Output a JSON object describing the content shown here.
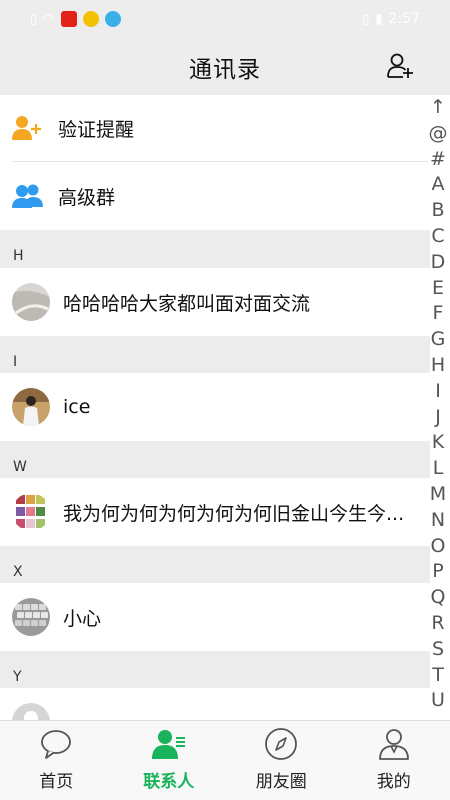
{
  "header": {
    "title": "通讯录"
  },
  "tools": [
    {
      "label": "验证提醒",
      "icon": "add-user-icon"
    },
    {
      "label": "高级群",
      "icon": "group-icon"
    }
  ],
  "sections": [
    {
      "letter": "H",
      "contacts": [
        {
          "name": "哈哈哈哈大家都叫面对面交流",
          "avatar": "photo-avatar"
        }
      ]
    },
    {
      "letter": "I",
      "contacts": [
        {
          "name": "ice",
          "avatar": "photo-avatar"
        }
      ]
    },
    {
      "letter": "W",
      "contacts": [
        {
          "name": "我为何为何为何为何为何旧金山今生今...",
          "avatar": "photo-avatar"
        }
      ]
    },
    {
      "letter": "X",
      "contacts": [
        {
          "name": "小心",
          "avatar": "photo-avatar"
        }
      ]
    },
    {
      "letter": "Y",
      "contacts": [
        {
          "name": "",
          "avatar": "default-avatar"
        }
      ]
    }
  ],
  "index_letters": [
    "↑",
    "@",
    "#",
    "A",
    "B",
    "C",
    "D",
    "E",
    "F",
    "G",
    "H",
    "I",
    "J",
    "K",
    "L",
    "M",
    "N",
    "O",
    "P",
    "Q",
    "R",
    "S",
    "T",
    "U"
  ],
  "tabs": [
    {
      "label": "首页",
      "icon": "chat-bubble-icon",
      "active": false
    },
    {
      "label": "联系人",
      "icon": "contacts-icon",
      "active": true
    },
    {
      "label": "朋友圈",
      "icon": "compass-icon",
      "active": false
    },
    {
      "label": "我的",
      "icon": "person-icon",
      "active": false
    }
  ],
  "status_bar": {
    "time": "2:57"
  },
  "colors": {
    "accent": "#18b35a",
    "tool_icon_orange": "#f5a623",
    "tool_icon_blue": "#2e9bf0",
    "section_bg": "#ececec",
    "header_bg": "#ededed"
  }
}
